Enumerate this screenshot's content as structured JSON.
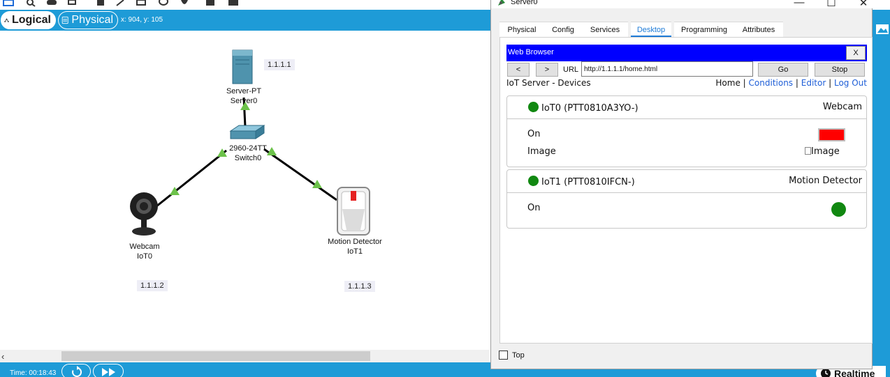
{
  "workspace": {
    "mode_logical": "Logical",
    "mode_physical": "Physical",
    "pointer_coords": "x: 904, y: 105",
    "accent_color": "#1e9bd7"
  },
  "devices": {
    "server": {
      "model": "Server-PT",
      "name": "Server0",
      "ip": "1.1.1.1"
    },
    "switch": {
      "model": "2960-24TT",
      "name": "Switch0"
    },
    "webcam": {
      "model": "Webcam",
      "name": "IoT0",
      "ip": "1.1.1.2"
    },
    "motion": {
      "model": "Motion Detector",
      "name": "IoT1",
      "ip": "1.1.1.3"
    }
  },
  "status_bar": {
    "time": "Time: 00:18:43",
    "realtime": "Realtime"
  },
  "window": {
    "title": "Server0",
    "tabs": [
      "Physical",
      "Config",
      "Services",
      "Desktop",
      "Programming",
      "Attributes"
    ],
    "active_tab": "Desktop",
    "top_checkbox_label": "Top"
  },
  "browser": {
    "title": "Web Browser",
    "close_label": "X",
    "back_label": "<",
    "forward_label": ">",
    "url_label": "URL",
    "url_value": "http://1.1.1.1/home.html",
    "go_label": "Go",
    "stop_label": "Stop"
  },
  "iot_page": {
    "heading": "IoT Server - Devices",
    "nav_home": "Home",
    "nav_sep": "|",
    "nav_conditions": "Conditions",
    "nav_editor": "Editor",
    "nav_logout": "Log Out",
    "cards": [
      {
        "name": "IoT0 (PTT0810A3YO-)",
        "type": "Webcam",
        "props": [
          {
            "label": "On",
            "value_color": "#ff0000"
          },
          {
            "label": "Image",
            "value_text": "Image"
          }
        ]
      },
      {
        "name": "IoT1 (PTT0810IFCN-)",
        "type": "Motion Detector",
        "props": [
          {
            "label": "On",
            "value_color": "#118811"
          }
        ]
      }
    ]
  }
}
